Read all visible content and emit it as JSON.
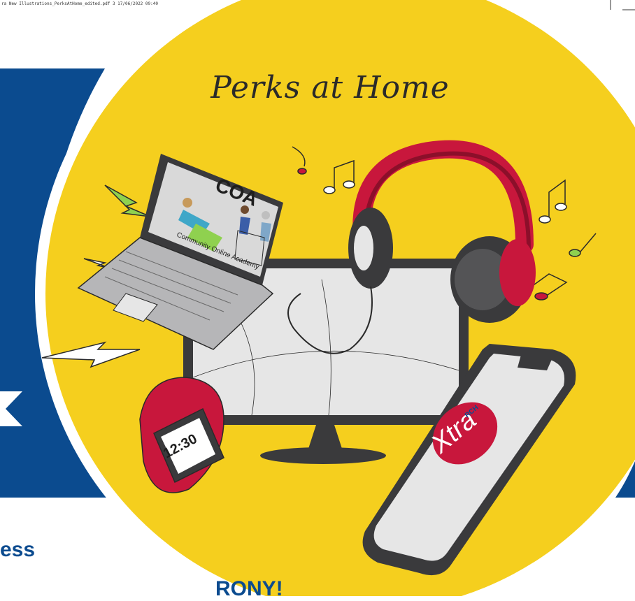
{
  "file_slug": "ra New Illustrations_PerksAtHome_edited.pdf    3    17/06/2022   09:40",
  "title": "Perks at Home",
  "laptop": {
    "screen_heading": "COA",
    "screen_caption": "Community Online Academy"
  },
  "watch": {
    "time": "12:30"
  },
  "phone": {
    "logo_main": "Xtra",
    "logo_small": "RCH"
  },
  "footer": {
    "line1": "ess",
    "line2": "RONY!"
  },
  "colors": {
    "background_circle": "#f5cf1e",
    "brand_blue": "#0b4b8f",
    "headphones_red": "#c8173c",
    "watch_red": "#c8173c",
    "device_dark": "#3a3a3c",
    "screen_light": "#e6e6e6"
  }
}
